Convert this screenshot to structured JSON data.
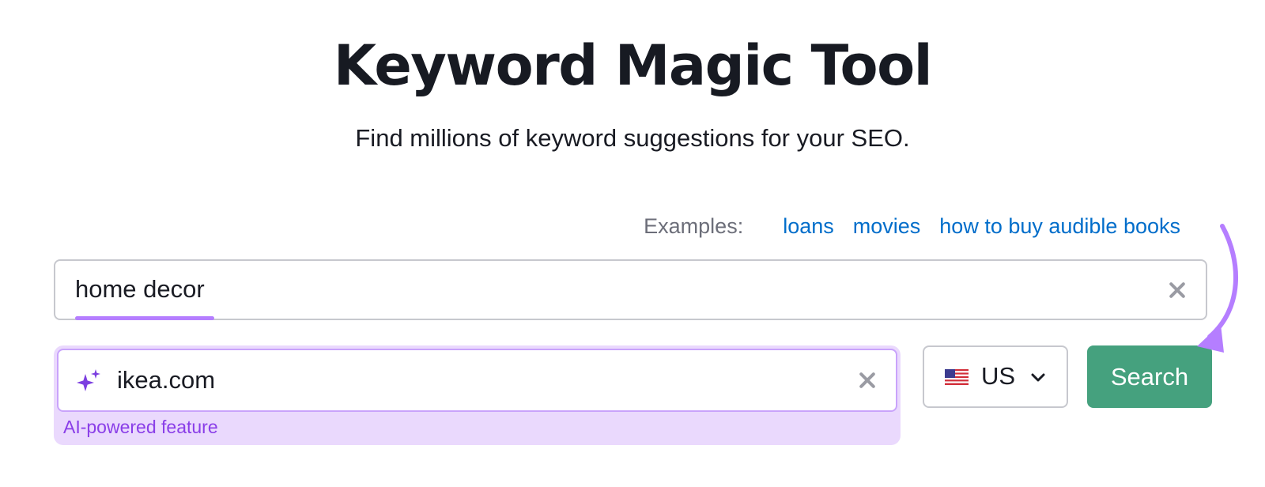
{
  "header": {
    "title": "Keyword Magic Tool",
    "subtitle": "Find millions of keyword suggestions for your SEO."
  },
  "examples": {
    "label": "Examples:",
    "links": [
      "loans",
      "movies",
      "how to buy audible books"
    ],
    "link_color": "#006dca"
  },
  "keyword_input": {
    "value": "home decor",
    "underline_color": "#b57eff"
  },
  "domain_input": {
    "value": "ikea.com",
    "icon": "sparkle-icon",
    "note": "AI-powered feature",
    "accent_color": "#8a3ee8",
    "background_color": "#ead9fd"
  },
  "country_select": {
    "value": "US",
    "icon": "us-flag-icon"
  },
  "search_button": {
    "label": "Search",
    "color": "#45a17e"
  },
  "annotation": {
    "icon": "curved-arrow-icon",
    "color": "#b57eff"
  }
}
